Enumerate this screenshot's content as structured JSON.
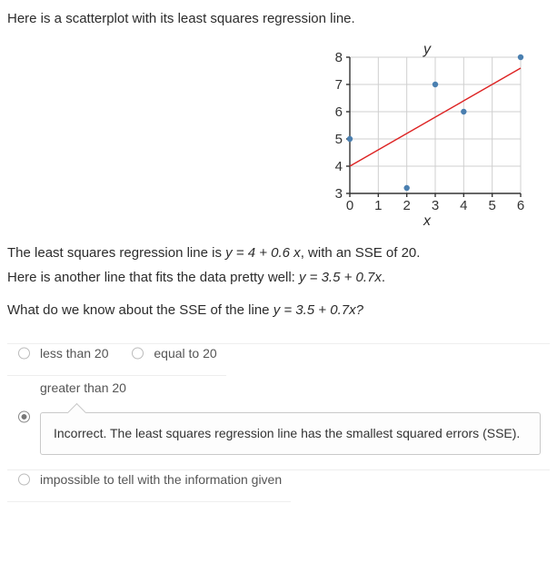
{
  "intro": "Here is a scatterplot with its least squares regression line.",
  "chart_data": {
    "type": "scatter",
    "title": "",
    "xlabel": "x",
    "ylabel": "y",
    "xlim": [
      0,
      6
    ],
    "ylim": [
      3,
      8
    ],
    "x_ticks": [
      0,
      1,
      2,
      3,
      4,
      5,
      6
    ],
    "y_ticks": [
      3,
      4,
      5,
      6,
      7,
      8
    ],
    "points": [
      {
        "x": 0,
        "y": 5
      },
      {
        "x": 2,
        "y": 3.2
      },
      {
        "x": 3,
        "y": 7
      },
      {
        "x": 4,
        "y": 6
      },
      {
        "x": 6,
        "y": 8
      }
    ],
    "line": {
      "slope": 0.6,
      "intercept": 4,
      "x0": 0,
      "x1": 6
    }
  },
  "explain1_a": "The least squares regression line is ",
  "explain1_eq": "y = 4 + 0.6 x",
  "explain1_b": ", with an SSE of 20.",
  "explain2_a": "Here is another line that fits the data pretty well: ",
  "explain2_eq": "y = 3.5 + 0.7x",
  "explain2_b": ".",
  "question_a": "What do we know about the SSE of the line ",
  "question_eq": "y = 3.5 + 0.7x?",
  "options": {
    "a": "less than 20",
    "b": "equal to 20",
    "c": "greater than 20",
    "d": "impossible to tell with the information given"
  },
  "feedback": "Incorrect.  The least squares regression line has the smallest squared errors (SSE)."
}
